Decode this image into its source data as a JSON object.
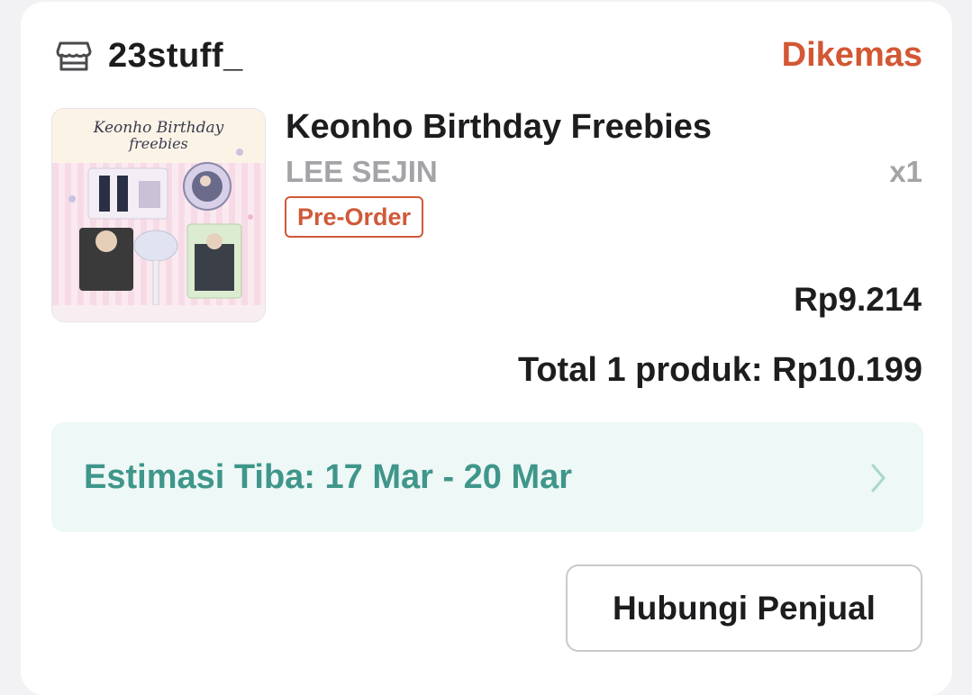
{
  "order": {
    "shop_name": "23stuff_",
    "status": "Dikemas",
    "status_color": "#d35733",
    "shop_icon": "store-icon"
  },
  "product": {
    "title": "Keonho Birthday Freebies",
    "variant": "LEE SEJIN",
    "quantity": "x1",
    "badge": "Pre-Order",
    "price": "Rp9.214",
    "image": {
      "title_line1": "Keonho Birthday",
      "title_line2": "freebies"
    }
  },
  "summary": {
    "total": "Total 1 produk: Rp10.199"
  },
  "delivery": {
    "estimate": "Estimasi Tiba: 17 Mar - 20 Mar",
    "accent_color": "#3f968a",
    "chevron_icon": "chevron-right-icon"
  },
  "actions": {
    "contact_seller": "Hubungi Penjual"
  }
}
